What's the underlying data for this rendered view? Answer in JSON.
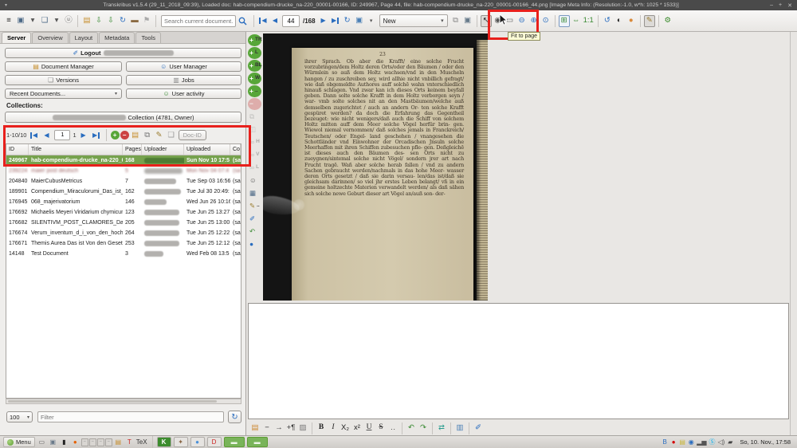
{
  "window": {
    "shade_glyph": "▾",
    "title": "Transkribus v1.5.4 (29_11_2018_09:39), Loaded doc: hab-compendium-drucke_na-220_00001-00166, ID: 249967, Page 44, file: hab-compendium-drucke_na-220_00001-00166_44.png [Image Meta Info: (Resolution:-1.0, w*h: 1025 * 1533)]",
    "minimize": "–",
    "maximize": "+",
    "close": "✕"
  },
  "toolbar": {
    "search_placeholder": "Search current document...",
    "page_current": "44",
    "page_total": "/168",
    "version_select": "New",
    "nav": {
      "first": "◀",
      "prev": "◀",
      "next": "▶",
      "last": "▶",
      "refresh": "↻",
      "save": "▣",
      "save_caret": "▾"
    },
    "groups": {
      "g1": [
        {
          "n": "main-menu-icon",
          "g": "≡",
          "c": "#333"
        },
        {
          "n": "snapshot-icon",
          "g": "▣",
          "c": "#4a6785"
        },
        {
          "n": "snapshot-caret-icon",
          "g": "▾",
          "c": "#555"
        },
        {
          "n": "layers-icon",
          "g": "❏",
          "c": "#4a6785"
        },
        {
          "n": "layers-caret-icon",
          "g": "▾",
          "c": "#555"
        },
        {
          "n": "user-badge-icon",
          "g": "ⓤ",
          "c": "#777"
        }
      ],
      "g2": [
        {
          "n": "open-folder-icon",
          "g": "▤",
          "c": "#c78f2e"
        },
        {
          "n": "import-document-icon",
          "g": "⇩",
          "c": "#3a8a33"
        },
        {
          "n": "export-document-icon",
          "g": "⇩",
          "c": "#3a8a33"
        },
        {
          "n": "sync-icon",
          "g": "↻",
          "c": "#2a6dbf"
        },
        {
          "n": "briefcase-icon",
          "g": "▬",
          "c": "#8a6a42"
        },
        {
          "n": "flag-icon",
          "g": "⚑",
          "c": "#aaa"
        }
      ],
      "clip": [
        {
          "n": "duplicate-page-icon",
          "g": "⧉",
          "c": "#888"
        },
        {
          "n": "clipboard-icon",
          "g": "▣",
          "c": "#667a8a"
        }
      ],
      "view": [
        {
          "n": "pointer-tool-icon",
          "g": "↖",
          "c": "#222",
          "p": true
        },
        {
          "n": "eye-icon",
          "g": "◉",
          "c": "#555"
        },
        {
          "n": "rect-select-icon",
          "g": "▭",
          "c": "#555"
        },
        {
          "n": "zoom-out-icon",
          "g": "⊖",
          "c": "#2a6dbf"
        },
        {
          "n": "zoom-in-icon",
          "g": "⊕",
          "c": "#2a6dbf"
        },
        {
          "n": "zoom-reset-icon",
          "g": "⊙",
          "c": "#2a6dbf"
        }
      ],
      "fit": [
        {
          "n": "fit-to-page-icon",
          "g": "⊞",
          "c": "#3a8a33",
          "h": true
        },
        {
          "n": "fit-width-icon",
          "g": "⇔",
          "c": "#3a8a33"
        },
        {
          "n": "original-size-icon",
          "g": "1:1",
          "c": "#3a8a33"
        }
      ],
      "image": [
        {
          "n": "rotate-icon",
          "g": "↺",
          "c": "#2a6dbf"
        },
        {
          "n": "contrast-icon",
          "g": "◐",
          "c": "#222"
        },
        {
          "n": "palette-icon",
          "g": "●",
          "c": "#d98a3a"
        }
      ],
      "edit": [
        {
          "n": "edit-pencil-icon",
          "g": "✎",
          "c": "#9a7b2d",
          "p": true
        }
      ],
      "jobs": [
        {
          "n": "job-manager-gear-icon",
          "g": "⚙",
          "c": "#3c8c2e"
        }
      ]
    }
  },
  "annotations": {
    "fit_tooltip": "Fit to page"
  },
  "sidebar": {
    "tabs": [
      {
        "label": "Server",
        "active": true
      },
      {
        "label": "Overview"
      },
      {
        "label": "Layout"
      },
      {
        "label": "Metadata"
      },
      {
        "label": "Tools"
      }
    ],
    "icons": {
      "logout": "✐",
      "docmgr": "▤",
      "usermgr": "☺",
      "versions": "❏",
      "jobs": "▥",
      "activity": "☺",
      "recent_caret": "▾"
    },
    "logout_label": "Logout",
    "document_manager": "Document Manager",
    "user_manager": "User Manager",
    "versions": "Versions",
    "jobs": "Jobs",
    "recent_documents": "Recent Documents...",
    "user_activity": "User activity",
    "collections_label": "Collections:",
    "collection_value": "Collection (4781, Owner)",
    "pager": {
      "range": "1-10/10",
      "page_value": "1",
      "page_count": "1",
      "doc_id_label": "Doc-ID",
      "icons": [
        {
          "n": "add-document-icon",
          "g": "+",
          "f": "#57a639"
        },
        {
          "n": "remove-document-icon",
          "g": "−",
          "f": "#cc4343"
        },
        {
          "n": "folder-icon",
          "g": "▤",
          "c": "#c78f2e"
        },
        {
          "n": "duplicate-icon",
          "g": "⧉",
          "c": "#777"
        },
        {
          "n": "edit-icon",
          "g": "✎",
          "c": "#9a7b2d"
        },
        {
          "n": "document-icon",
          "g": "❏",
          "c": "#999"
        }
      ]
    },
    "table": {
      "columns": [
        "ID",
        "Title",
        "Pages",
        "Uploader",
        "Uploaded",
        "Collection"
      ],
      "rows": [
        {
          "id": "249967",
          "title": "hab-compendium-drucke_na-220_00001-00166",
          "pages": "168",
          "uploaded": "Sun Nov 10 17:5",
          "coll": "(sar",
          "selected": true,
          "blurw": 58
        },
        {
          "id": "239224",
          "title": "maier post deutsch",
          "pages": "5",
          "uploaded": "Mon Nov 04 07:4",
          "coll": "(sar",
          "blurred": true,
          "blurw": 48
        },
        {
          "id": "204840",
          "title": "MaierCubusMetricus",
          "pages": "7",
          "uploaded": "Tue Sep 03 16:56",
          "coll": "(sar",
          "blurw": 40
        },
        {
          "id": "189901",
          "title": "Compendium_Miraculorumi_Das_ist_Kurtzer",
          "pages": "162",
          "uploaded": "Tue Jul 30 20:49:",
          "coll": "(sar",
          "blurw": 46
        },
        {
          "id": "176945",
          "title": "068_majerivatorium",
          "pages": "146",
          "uploaded": "Wed Jun 26 10:16",
          "coll": "(sar",
          "blurw": 28
        },
        {
          "id": "176692",
          "title": "Michaelis Meyeri Viridarium chymicum",
          "pages": "123",
          "uploaded": "Tue Jun 25 13:27",
          "coll": "(sar",
          "blurw": 44
        },
        {
          "id": "176682",
          "title": "SILENTIVM_POST_CLAMORES_Das_ist_A",
          "pages": "205",
          "uploaded": "Tue Jun 25 13:00",
          "coll": "(sar",
          "blurw": 44
        },
        {
          "id": "176674",
          "title": "Verum_inventum_d_i_von_den_hochnützlich",
          "pages": "264",
          "uploaded": "Tue Jun 25 12:22",
          "coll": "(sar",
          "blurw": 44
        },
        {
          "id": "176671",
          "title": "Themis Aurea Das ist Von den Gesetzen",
          "pages": "253",
          "uploaded": "Tue Jun 25 12:12",
          "coll": "(sar",
          "blurw": 44
        },
        {
          "id": "14148",
          "title": "Test Document",
          "pages": "3",
          "uploaded": "Wed Feb 08 13:5",
          "coll": "(sar",
          "blurw": 24
        }
      ]
    },
    "page_size": "100",
    "filter_placeholder": "Filter"
  },
  "canvas_tools": [
    {
      "n": "add-textregion-button",
      "g": "+",
      "f": "#57a639",
      "t": "TR"
    },
    {
      "n": "add-line-button",
      "g": "+",
      "f": "#57a639",
      "t": "L"
    },
    {
      "n": "add-baseline-button",
      "g": "+",
      "f": "#57a639",
      "t": "BL"
    },
    {
      "n": "add-word-button",
      "g": "+",
      "f": "#57a639",
      "t": "W"
    },
    {
      "n": "add-other-button",
      "g": "+",
      "f": "#57a639",
      "t": ".."
    },
    {
      "n": "remove-shape-button",
      "g": "−",
      "f": "#cc4343",
      "d": true
    },
    {
      "n": "merge-shapes-button",
      "g": "⧉",
      "c": "#777",
      "d": true
    },
    {
      "n": "split-shape-button",
      "g": "◫",
      "c": "#777",
      "d": true
    },
    {
      "n": "link-horizontal-button",
      "g": "∞",
      "c": "#777",
      "t": "H",
      "d": true
    },
    {
      "n": "link-vertical-button",
      "g": "∞",
      "c": "#777",
      "t": "V",
      "d": true
    },
    {
      "n": "link-logical-button",
      "g": "∞",
      "c": "#777",
      "t": "L",
      "d": true
    },
    {
      "n": "reading-order-button",
      "g": "☺",
      "c": "#555"
    },
    {
      "n": "table-tool-button",
      "g": "▦",
      "c": "#4a6785"
    },
    {
      "n": "edit-attributes-button",
      "g": "✎",
      "c": "#9a7b2d",
      "t": ".."
    },
    {
      "n": "pen-tool-button",
      "g": "✐",
      "c": "#2a6dbf"
    },
    {
      "n": "canvas-undo-button",
      "g": "↶",
      "c": "#3a8a33"
    },
    {
      "n": "help-button",
      "g": "●",
      "c": "#2a6dbf"
    }
  ],
  "book_page": {
    "page_number": "23",
    "lines": [
      "ihrer Sprach. Ob aber die Krafft/ eine solche",
      "Frucht vorzubringen/dem Holtz deren Orts/oder",
      "den Bäumen / oder den Würmlein so auß dem",
      "Holtz wachsen/vnd in den Muscheln hangen / zu",
      "zuschreiben sey, wird allhie nicht vnbillich gefragt/",
      "wie dañ obgemeldte Authores auff solchē wahn",
      "vnterschiedlich hinauß schlagen. Vnd zwar kan",
      "ich dieses Orts keinem beyfall geben. Dann solte",
      "solche Krafft in dem Holtz verborgen seyn / war-",
      "vmb solte solches nit an den Mastbäumen/welche",
      "auß demselben zugerichtet / auch an andern Or-",
      "ten solche Krafft gespüret werden? da doch die",
      "Erfahrung das Gegentheil bezeuget: wie nicht",
      "wenigers/daß auch die Schiff von solchem Holtz",
      "mitten auff dem Meer solche Vögel herfür brin-",
      "gen. Wiewol niemal vernommen/ daß solches",
      "jemals in Franckreich/ Teutschen/ oder Engel-",
      "land geschehen / vnangesehen die Schottländer",
      "vnd Einwohner der Orcadischen Jnsuln solche",
      "Meerhaffen mit ihren Schiffen zubesuchen pfle-",
      "gen. Deßgleichē ist dieses auch den Bäumen des-",
      "sen Orts nicht zu zueygnen/sintemal solche nicht",
      "Vögel/ sondern jrer art nach Frucht tragē. Wañ",
      "aber solche herab fallen / vnd zu andern Sachen",
      "gebraucht werden/nachmals in das hohe Meer-",
      "wasser deren Orts gesetzt / daß sie darin versau-",
      "len/das ist/daß sie gleichsam darinnen/ so viel jhr",
      "erstes Leben belangt/ vñ in ein gemeine holtzechte",
      "Materien verwandelt werden/ als dañ sähen sich",
      "solche newe Geburt dieser art Vögel an/auß son-",
      "der-"
    ]
  },
  "text_toolbar": [
    {
      "n": "tag-icon",
      "g": "▤",
      "c": "#cc8833"
    },
    {
      "n": "dash-icon",
      "g": "−",
      "c": "#333"
    },
    {
      "n": "gap-arrow-icon",
      "g": "→",
      "c": "#333"
    },
    {
      "n": "add-paragraph-icon",
      "g": "+¶",
      "c": "#333"
    },
    {
      "n": "image-icon",
      "g": "▨",
      "c": "#777"
    },
    {
      "sep": true
    },
    {
      "n": "bold-button",
      "g": "B",
      "c": "#222",
      "style": "b"
    },
    {
      "n": "italic-button",
      "g": "I",
      "c": "#222",
      "style": "i"
    },
    {
      "n": "subscript-button",
      "g": "X₂",
      "c": "#222"
    },
    {
      "n": "superscript-button",
      "g": "x²",
      "c": "#222"
    },
    {
      "n": "underline-button",
      "g": "U",
      "c": "#222",
      "style": "u"
    },
    {
      "n": "strikethrough-button",
      "g": "S",
      "c": "#222",
      "style": "s"
    },
    {
      "n": "more-styles-button",
      "g": "‥",
      "c": "#555"
    },
    {
      "sep": true
    },
    {
      "n": "undo-button",
      "g": "↶",
      "c": "#3a8a33"
    },
    {
      "n": "redo-button",
      "g": "↷",
      "c": "#3a8a33"
    },
    {
      "sep": true
    },
    {
      "n": "swap-button",
      "g": "⇄",
      "c": "#2a9d8f"
    },
    {
      "sep": true
    },
    {
      "n": "columns-button",
      "g": "▥",
      "c": "#4a7fb5"
    },
    {
      "sep": true
    },
    {
      "n": "pen-button",
      "g": "✐",
      "c": "#2a6dbf"
    }
  ],
  "taskbar": {
    "menu_label": "Menu",
    "launchers": [
      {
        "n": "show-desktop-button",
        "g": "▭",
        "c": "#555"
      },
      {
        "n": "save-session-icon",
        "g": "▣",
        "c": "#6a7a8a"
      },
      {
        "n": "terminal-icon",
        "g": "▮",
        "c": "#222"
      },
      {
        "n": "firefox-icon",
        "g": "●",
        "c": "#e66000"
      },
      {
        "n": "workspace-1-button",
        "g": "–",
        "cls": "ws"
      },
      {
        "n": "workspace-2-button",
        "g": "–",
        "cls": "ws"
      },
      {
        "n": "workspace-3-button",
        "g": "–",
        "cls": "ws"
      },
      {
        "n": "workspace-4-button",
        "g": "–",
        "cls": "ws"
      },
      {
        "n": "files-icon",
        "g": "▤",
        "c": "#c78f2e"
      },
      {
        "n": "text-tool-icon",
        "g": "T",
        "c": "#cc2222"
      },
      {
        "n": "tex-icon",
        "g": "TeX",
        "c": "#333"
      }
    ],
    "windows": [
      {
        "n": "taskbar-window-kate",
        "g": "K",
        "f": "#3c8c2e",
        "cls": "win"
      },
      {
        "n": "taskbar-window-app",
        "g": "✦",
        "c": "#886644",
        "cls": "win"
      },
      {
        "n": "taskbar-window-chrome",
        "g": "●",
        "c": "#4a90d9",
        "cls": "win"
      },
      {
        "n": "taskbar-window-d",
        "g": "D",
        "c": "#cc2222",
        "cls": "win"
      },
      {
        "n": "taskbar-window-green-1",
        "g": "▬",
        "c": "#eef6e8",
        "cls": "win wide"
      },
      {
        "n": "taskbar-window-green-2",
        "g": "▬",
        "c": "#eef6e8",
        "cls": "win wide"
      }
    ],
    "tray": [
      {
        "n": "bluetooth-icon",
        "g": "B",
        "c": "#2a6dbf"
      },
      {
        "n": "recording-icon",
        "g": "●",
        "c": "#d40000"
      },
      {
        "n": "display-icon",
        "g": "▤",
        "c": "#c9b637"
      },
      {
        "n": "shield-icon",
        "g": "◉",
        "c": "#2a6dbf"
      },
      {
        "n": "network-signal-icon",
        "g": "▂▅",
        "c": "#555"
      },
      {
        "n": "skype-icon",
        "g": "Ⓢ",
        "c": "#00aff0"
      },
      {
        "n": "volume-icon",
        "g": "◁)",
        "c": "#555"
      },
      {
        "n": "battery-icon",
        "g": "▰",
        "c": "#444"
      }
    ],
    "clock": "So, 10. Nov., 17:58"
  }
}
